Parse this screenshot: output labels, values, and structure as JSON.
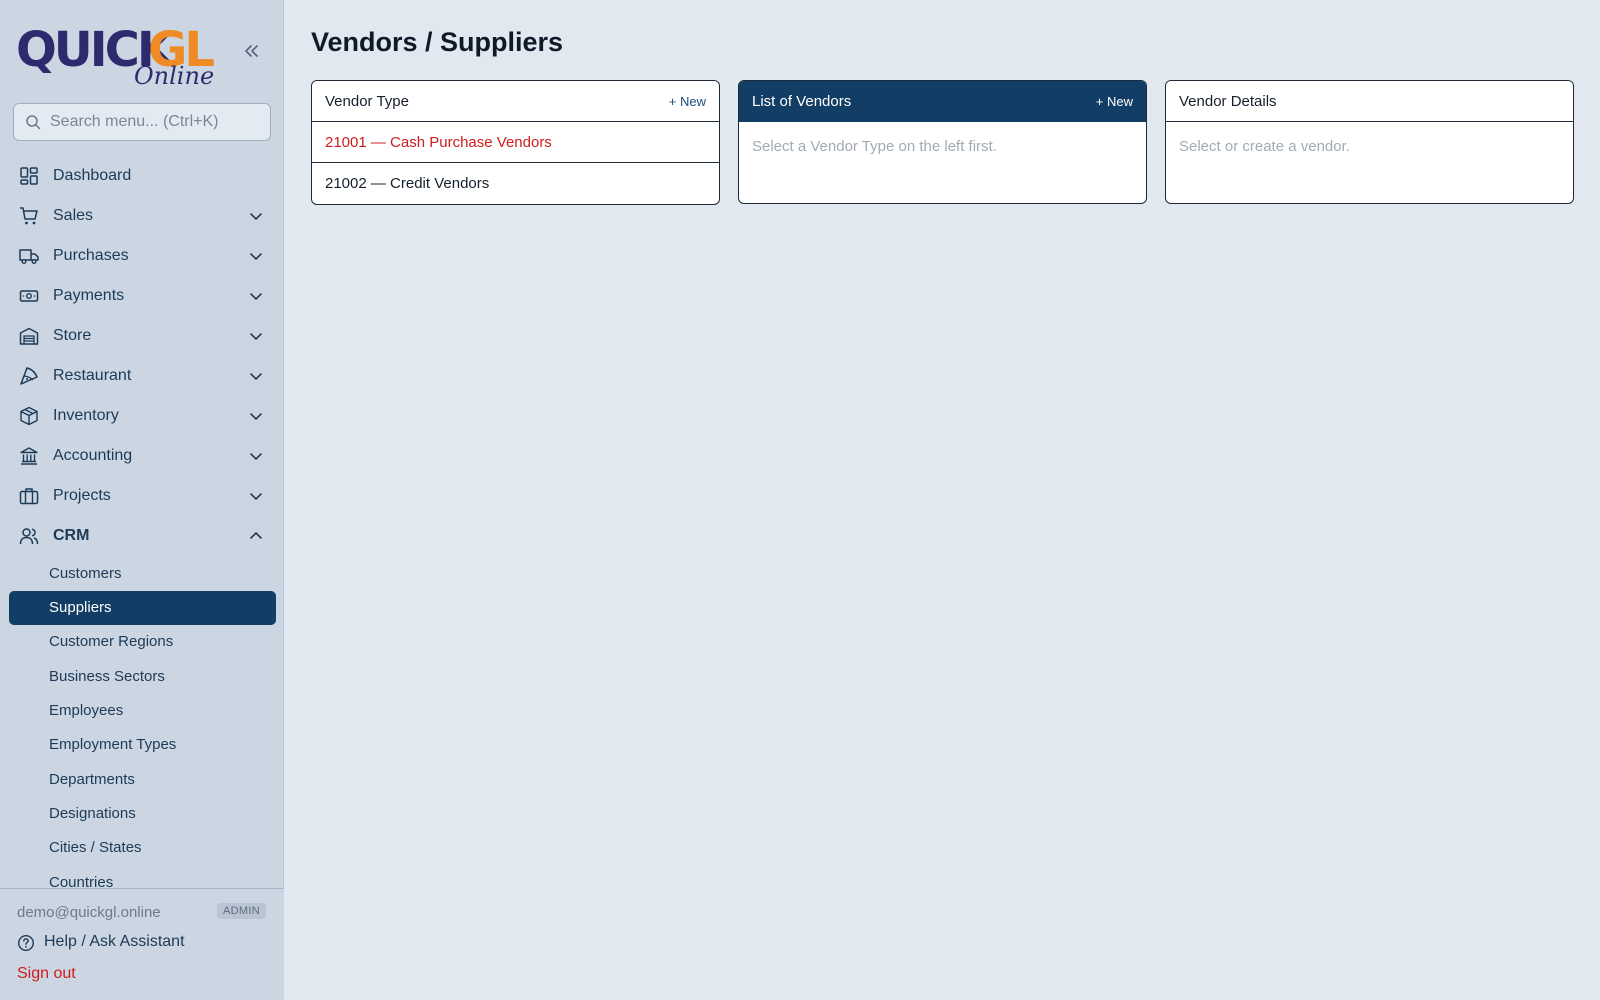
{
  "sidebar": {
    "logo": {
      "main": "QuickGL",
      "sub": "Online"
    },
    "search": {
      "placeholder": "Search menu... (Ctrl+K)",
      "value": ""
    },
    "items": [
      {
        "label": "Dashboard",
        "icon": "dashboard-icon"
      },
      {
        "label": "Sales",
        "icon": "cart-icon"
      },
      {
        "label": "Purchases",
        "icon": "truck-icon"
      },
      {
        "label": "Payments",
        "icon": "money-icon"
      },
      {
        "label": "Store",
        "icon": "warehouse-icon"
      },
      {
        "label": "Restaurant",
        "icon": "pizza-icon"
      },
      {
        "label": "Inventory",
        "icon": "box-icon"
      },
      {
        "label": "Accounting",
        "icon": "bank-icon"
      },
      {
        "label": "Projects",
        "icon": "briefcase-icon"
      },
      {
        "label": "CRM",
        "icon": "users-icon"
      }
    ],
    "crm_subitems": [
      "Customers",
      "Suppliers",
      "Customer Regions",
      "Business Sectors",
      "Employees",
      "Employment Types",
      "Departments",
      "Designations",
      "Cities / States",
      "Countries"
    ],
    "footer": {
      "email": "demo@quickgl.online",
      "role": "ADMIN",
      "help": "Help / Ask Assistant",
      "signout": "Sign out"
    }
  },
  "main": {
    "title": "Vendors / Suppliers",
    "vendor_type": {
      "title": "Vendor Type",
      "new_label": "+ New",
      "rows": [
        "21001 — Cash Purchase Vendors",
        "21002 — Credit Vendors"
      ]
    },
    "vendor_list": {
      "title": "List of Vendors",
      "new_label": "+ New",
      "empty": "Select a Vendor Type on the left first."
    },
    "vendor_details": {
      "title": "Vendor Details",
      "empty": "Select or create a vendor."
    }
  },
  "colors": {
    "accent": "#123d64",
    "danger": "#cf1c1c",
    "logo_blue": "#2e2a6e",
    "logo_orange": "#f08a24"
  }
}
